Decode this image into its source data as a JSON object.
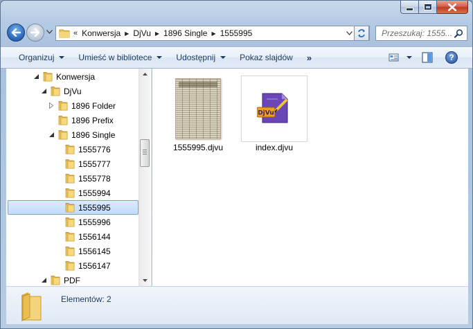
{
  "address": {
    "lead": "«",
    "crumbs": [
      "Konwersja",
      "DjVu",
      "1896 Single",
      "1555995"
    ]
  },
  "search": {
    "placeholder": "Przeszukaj: 1555..."
  },
  "toolbar": {
    "organize": "Organizuj",
    "library": "Umieść w bibliotece",
    "share": "Udostępnij",
    "slideshow": "Pokaz slajdów",
    "more": "»",
    "help": "?"
  },
  "tree": [
    {
      "label": "Konwersja",
      "level": 0,
      "state": "expanded"
    },
    {
      "label": "DjVu",
      "level": 1,
      "state": "expanded"
    },
    {
      "label": "1896 Folder",
      "level": 2,
      "state": "collapsed"
    },
    {
      "label": "1896 Prefix",
      "level": 2,
      "state": "none"
    },
    {
      "label": "1896 Single",
      "level": 2,
      "state": "expanded"
    },
    {
      "label": "1555776",
      "level": 3,
      "state": "none"
    },
    {
      "label": "1555777",
      "level": 3,
      "state": "none"
    },
    {
      "label": "1555778",
      "level": 3,
      "state": "none"
    },
    {
      "label": "1555994",
      "level": 3,
      "state": "none"
    },
    {
      "label": "1555995",
      "level": 3,
      "state": "none",
      "selected": true
    },
    {
      "label": "1555996",
      "level": 3,
      "state": "none"
    },
    {
      "label": "1556144",
      "level": 3,
      "state": "none"
    },
    {
      "label": "1556145",
      "level": 3,
      "state": "none"
    },
    {
      "label": "1556147",
      "level": 3,
      "state": "none"
    },
    {
      "label": "PDF",
      "level": 1,
      "state": "expanded"
    }
  ],
  "files": [
    {
      "name": "1555995.djvu",
      "icon": "newspaper-thumbnail"
    },
    {
      "name": "index.djvu",
      "icon": "djvu-file-icon",
      "badge": "DjVu"
    }
  ],
  "details": {
    "text": "Elementów: 2"
  }
}
